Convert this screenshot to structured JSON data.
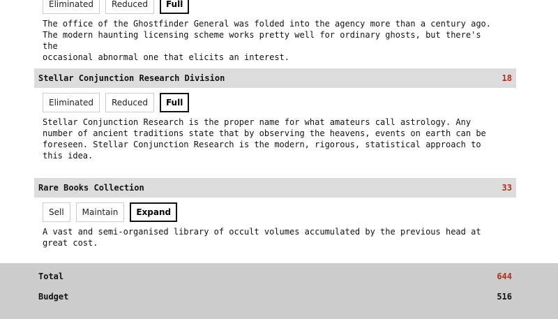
{
  "sections": [
    {
      "options": [
        "Eliminated",
        "Reduced",
        "Full"
      ],
      "selected": "Full",
      "description_lines": [
        "The office of the Ghostfinder General was folded into the agency more than a century ago.",
        "The modern haunting licensing scheme works pretty well for ordinary ghosts, but there's the",
        "occasional abnormal one that elicits an interest."
      ]
    },
    {
      "title": "Stellar Conjunction Research Division",
      "cost": "18",
      "options": [
        "Eliminated",
        "Reduced",
        "Full"
      ],
      "selected": "Full",
      "description_lines": [
        "Stellar Conjunction Research is the proper name for what amateurs call astrology. Any",
        "number of ancient traditions state that by observing the heavens, events on earth can be",
        "foreseen. Stellar Conjunction Research is the modern, rigorous, statistical approach to",
        "this idea."
      ]
    },
    {
      "title": "Rare Books Collection",
      "cost": "33",
      "options": [
        "Sell",
        "Maintain",
        "Expand"
      ],
      "selected": "Expand",
      "description_lines": [
        "A vast and semi-organised library of occult volumes accumulated by the previous head at",
        "great cost."
      ]
    }
  ],
  "footer": {
    "total_label": "Total",
    "total_value": "644",
    "budget_label": "Budget",
    "budget_value": "516"
  },
  "colors": {
    "over_budget_red": "#a8321c",
    "section_header_bg": "#dcdcdc",
    "footer_bg": "#cccccc"
  }
}
